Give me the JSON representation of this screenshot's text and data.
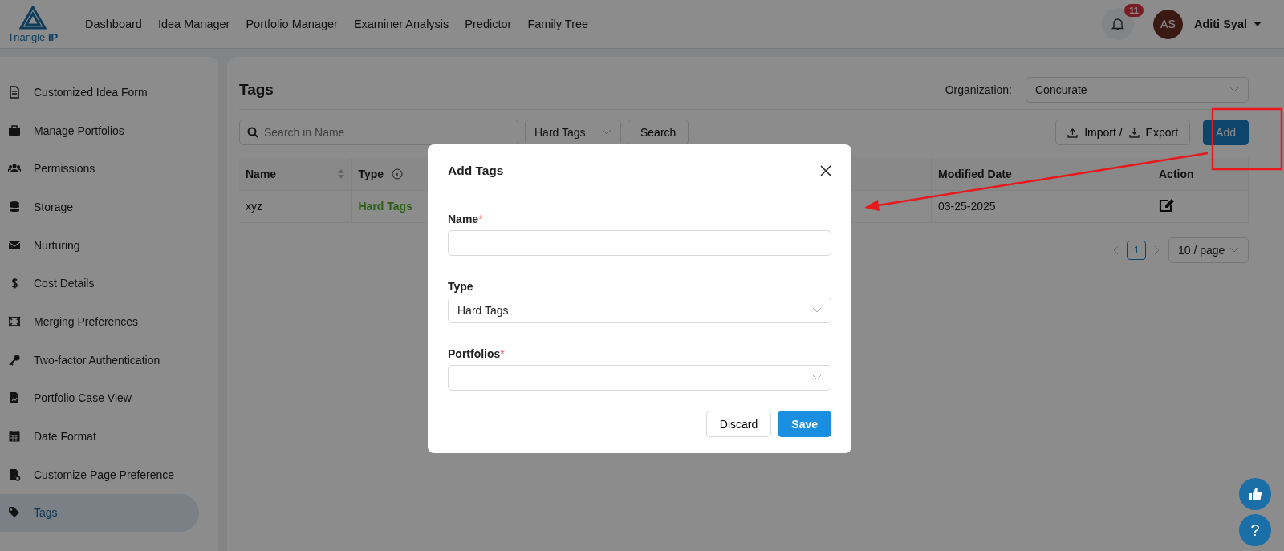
{
  "header": {
    "logo": "Triangle **IP**",
    "nav": [
      {
        "label": "Dashboard"
      },
      {
        "label": "Idea Manager"
      },
      {
        "label": "Portfolio Manager"
      },
      {
        "label": "Examiner Analysis"
      },
      {
        "label": "Predictor"
      },
      {
        "label": "Family Tree"
      }
    ],
    "notification_count": "11",
    "user": {
      "initials": "AS",
      "name": "Aditi Syal"
    }
  },
  "sidebar": {
    "items": [
      {
        "label": "Customized Idea Form",
        "selected": false
      },
      {
        "label": "Manage Portfolios",
        "selected": false
      },
      {
        "label": "Permissions",
        "selected": false
      },
      {
        "label": "Storage",
        "selected": false
      },
      {
        "label": "Nurturing",
        "selected": false
      },
      {
        "label": "Cost Details",
        "selected": false
      },
      {
        "label": "Merging Preferences",
        "selected": false
      },
      {
        "label": "Two-factor Authentication",
        "selected": false
      },
      {
        "label": "Portfolio Case View",
        "selected": false
      },
      {
        "label": "Date Format",
        "selected": false
      },
      {
        "label": "Customize Page Preference",
        "selected": false
      },
      {
        "label": "Tags",
        "selected": true
      }
    ]
  },
  "main": {
    "title": "Tags",
    "organization": {
      "label": "Organization:",
      "value": "Concurate"
    },
    "search": {
      "placeholder": "Search in Name"
    },
    "type_filter": "Hard Tags",
    "search_button": "Search",
    "import_label": "Import /",
    "export_label": "Export",
    "add_button": "Add",
    "table": {
      "columns": [
        {
          "label": "Name",
          "kind": "sort"
        },
        {
          "label": "Type",
          "kind": "info"
        },
        {
          "label": "Modified Date",
          "kind": "plain"
        },
        {
          "label": "Action",
          "kind": "plain"
        }
      ],
      "rows": [
        {
          "name": "xyz",
          "type": "Hard Tags",
          "modified_date": "03-25-2025"
        }
      ]
    },
    "pagination": {
      "page": "1",
      "page_size": "10 / page"
    }
  },
  "modal": {
    "title": "Add Tags",
    "fields": [
      {
        "label": "Name",
        "required_mark": "*",
        "kind": "text"
      },
      {
        "label": "Type",
        "kind": "select",
        "value": "Hard Tags"
      },
      {
        "label": "Portfolios",
        "required_mark": "*",
        "kind": "select"
      }
    ],
    "buttons": [
      {
        "label": "Discard",
        "kind": "default"
      },
      {
        "label": "Save",
        "kind": "primary"
      }
    ]
  },
  "help_button": "?"
}
